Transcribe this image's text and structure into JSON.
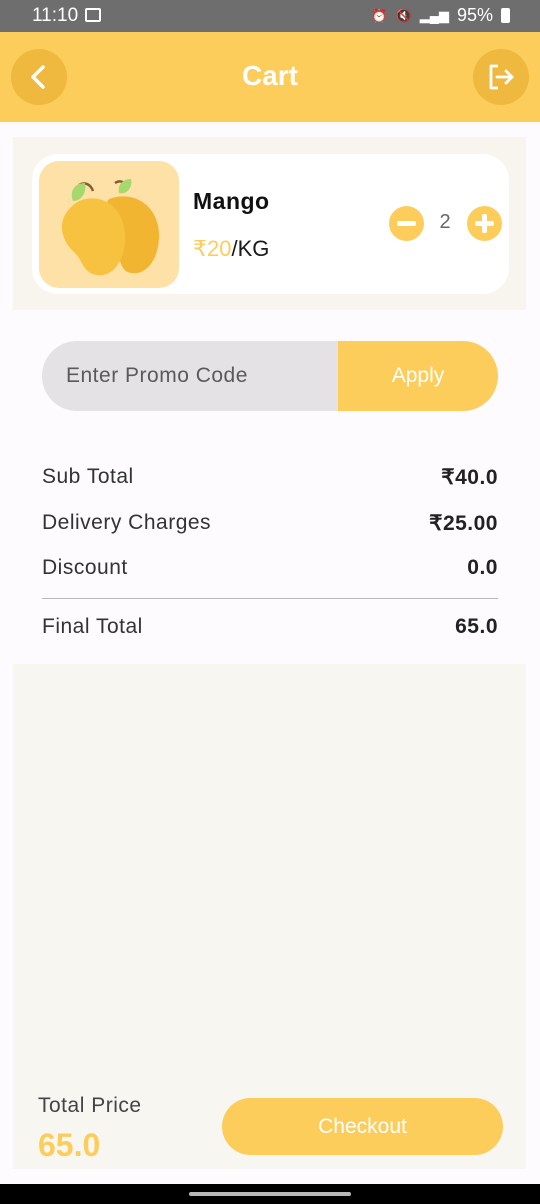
{
  "status_bar": {
    "time": "11:10",
    "battery": "95%",
    "icons": [
      "image-icon",
      "alarm-icon",
      "mute-icon",
      "volte-icon",
      "5g-icon",
      "signal-icon",
      "battery-icon"
    ]
  },
  "header": {
    "title": "Cart",
    "back_icon": "chevron-left-icon",
    "logout_icon": "logout-icon",
    "background": "#fdcd5b"
  },
  "cart": {
    "items": [
      {
        "name": "Mango",
        "price": "₹20",
        "unit": "/KG",
        "quantity": "2",
        "image_icon": "mango-icon"
      }
    ]
  },
  "promo": {
    "placeholder": "Enter Promo Code",
    "value": "",
    "apply_label": "Apply"
  },
  "summary": {
    "sub_total_label": "Sub Total",
    "sub_total_value": "₹40.0",
    "delivery_label": "Delivery Charges",
    "delivery_value": "₹25.00",
    "discount_label": "Discount",
    "discount_value": "0.0",
    "final_total_label": "Final Total",
    "final_total_value": "65.0"
  },
  "footer": {
    "total_price_label": "Total Price",
    "total_price_value": "65.0",
    "checkout_label": "Checkout"
  },
  "colors": {
    "accent": "#fdcd5b",
    "accent_dark": "#efb83e",
    "panel": "#f8f6f1"
  }
}
